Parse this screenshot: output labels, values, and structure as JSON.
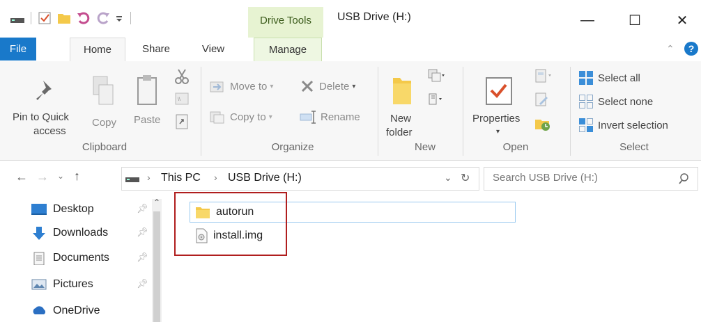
{
  "window": {
    "title": "USB Drive (H:)",
    "context_tab_group": "Drive Tools",
    "controls": {
      "minimize": "—",
      "maximize": "☐",
      "close": "✕"
    }
  },
  "tabs": [
    {
      "label": "File",
      "active": false
    },
    {
      "label": "Home",
      "active": true
    },
    {
      "label": "Share",
      "active": false
    },
    {
      "label": "View",
      "active": false
    },
    {
      "label": "Manage",
      "active": false
    }
  ],
  "ribbon": {
    "clipboard": {
      "pin_label": "Pin to Quick access",
      "pin_line1": "Pin to Quick",
      "pin_line2": "access",
      "copy_label": "Copy",
      "paste_label": "Paste",
      "group_label": "Clipboard"
    },
    "organize": {
      "move_to": "Move to",
      "copy_to": "Copy to",
      "delete": "Delete",
      "rename": "Rename",
      "group_label": "Organize"
    },
    "new": {
      "new_folder_line1": "New",
      "new_folder_line2": "folder",
      "group_label": "New"
    },
    "open": {
      "properties": "Properties",
      "group_label": "Open"
    },
    "select": {
      "select_all": "Select all",
      "select_none": "Select none",
      "invert_selection": "Invert selection",
      "group_label": "Select"
    }
  },
  "address": {
    "crumbs": [
      "This PC",
      "USB Drive (H:)"
    ],
    "search_placeholder": "Search USB Drive (H:)"
  },
  "nav_pane": {
    "items": [
      {
        "label": "Desktop",
        "icon": "desktop-icon",
        "pinned": true
      },
      {
        "label": "Downloads",
        "icon": "download-icon",
        "pinned": true
      },
      {
        "label": "Documents",
        "icon": "documents-icon",
        "pinned": true
      },
      {
        "label": "Pictures",
        "icon": "pictures-icon",
        "pinned": true
      },
      {
        "label": "OneDrive",
        "icon": "cloud-icon",
        "pinned": false
      }
    ]
  },
  "files": [
    {
      "name": "autorun",
      "type": "folder"
    },
    {
      "name": "install.img",
      "type": "disc-image"
    }
  ],
  "colors": {
    "file_tab": "#1979ca",
    "drive_tools_bg": "#e7f3d2",
    "highlight_box": "#b01e1e",
    "folder": "#f4c94a"
  }
}
